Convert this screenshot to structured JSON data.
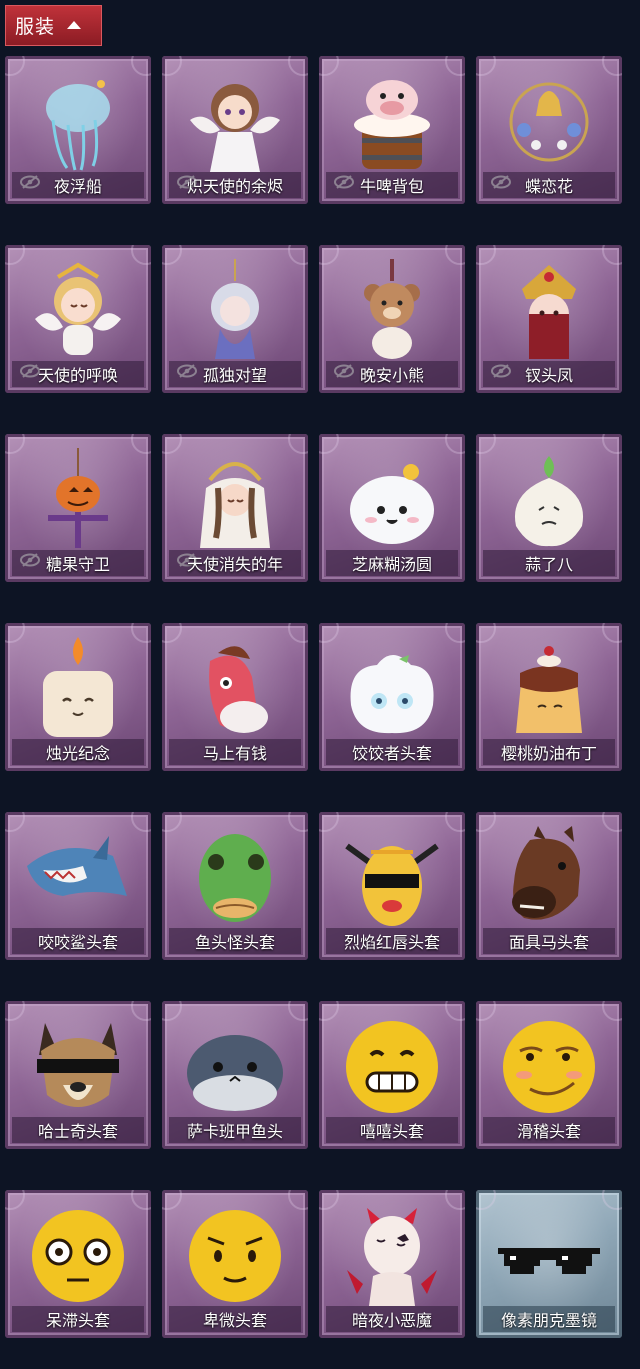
{
  "header": {
    "tab_label": "服装"
  },
  "items": [
    {
      "name": "夜浮船",
      "hidden": true,
      "icon": "jellyfish-icon",
      "theme": "purple"
    },
    {
      "name": "炽天使的余烬",
      "hidden": true,
      "icon": "angel-girl-icon",
      "theme": "purple"
    },
    {
      "name": "牛啤背包",
      "hidden": true,
      "icon": "cow-beer-barrel-icon",
      "theme": "purple"
    },
    {
      "name": "蝶恋花",
      "hidden": true,
      "icon": "bell-ornament-icon",
      "theme": "purple"
    },
    {
      "name": "天使的呼唤",
      "hidden": true,
      "icon": "angel-doll-icon",
      "theme": "purple"
    },
    {
      "name": "孤独对望",
      "hidden": true,
      "icon": "hanging-doll-icon",
      "theme": "purple"
    },
    {
      "name": "晚安小熊",
      "hidden": true,
      "icon": "teddy-bear-icon",
      "theme": "purple"
    },
    {
      "name": "钗头凤",
      "hidden": true,
      "icon": "phoenix-crown-doll-icon",
      "theme": "purple"
    },
    {
      "name": "糖果守卫",
      "hidden": true,
      "icon": "pumpkin-scarecrow-icon",
      "theme": "purple"
    },
    {
      "name": "天使消失的年",
      "hidden": true,
      "icon": "veiled-doll-icon",
      "theme": "purple"
    },
    {
      "name": "芝麻糊汤圆",
      "hidden": false,
      "icon": "rice-ball-icon",
      "theme": "purple"
    },
    {
      "name": "蒜了八",
      "hidden": false,
      "icon": "garlic-icon",
      "theme": "purple"
    },
    {
      "name": "烛光纪念",
      "hidden": false,
      "icon": "candle-icon",
      "theme": "purple"
    },
    {
      "name": "马上有钱",
      "hidden": false,
      "icon": "pink-horse-icon",
      "theme": "purple"
    },
    {
      "name": "饺饺者头套",
      "hidden": false,
      "icon": "dumpling-icon",
      "theme": "purple"
    },
    {
      "name": "樱桃奶油布丁",
      "hidden": false,
      "icon": "pudding-icon",
      "theme": "purple"
    },
    {
      "name": "咬咬鲨头套",
      "hidden": false,
      "icon": "shark-icon",
      "theme": "purple"
    },
    {
      "name": "鱼头怪头套",
      "hidden": false,
      "icon": "fish-head-icon",
      "theme": "purple"
    },
    {
      "name": "烈焰红唇头套",
      "hidden": false,
      "icon": "yellow-mask-icon",
      "theme": "purple"
    },
    {
      "name": "面具马头套",
      "hidden": false,
      "icon": "horse-mask-icon",
      "theme": "purple"
    },
    {
      "name": "哈士奇头套",
      "hidden": false,
      "icon": "husky-icon",
      "theme": "purple"
    },
    {
      "name": "萨卡班甲鱼头",
      "hidden": false,
      "icon": "sacabambaspis-icon",
      "theme": "purple"
    },
    {
      "name": "嘻嘻头套",
      "hidden": false,
      "icon": "grin-emoji-icon",
      "theme": "purple"
    },
    {
      "name": "滑稽头套",
      "hidden": false,
      "icon": "smirk-emoji-icon",
      "theme": "purple"
    },
    {
      "name": "呆滞头套",
      "hidden": false,
      "icon": "stare-emoji-icon",
      "theme": "purple"
    },
    {
      "name": "卑微头套",
      "hidden": false,
      "icon": "pleading-emoji-icon",
      "theme": "purple"
    },
    {
      "name": "暗夜小恶魔",
      "hidden": false,
      "icon": "little-devil-icon",
      "theme": "purple"
    },
    {
      "name": "像素朋克墨镜",
      "hidden": false,
      "icon": "pixel-sunglasses-icon",
      "theme": "blue"
    }
  ],
  "colors": {
    "background": "#0d1424",
    "tab": "#b02a32",
    "card_purple": "#8e6595",
    "card_blue": "#8ea6b6"
  }
}
